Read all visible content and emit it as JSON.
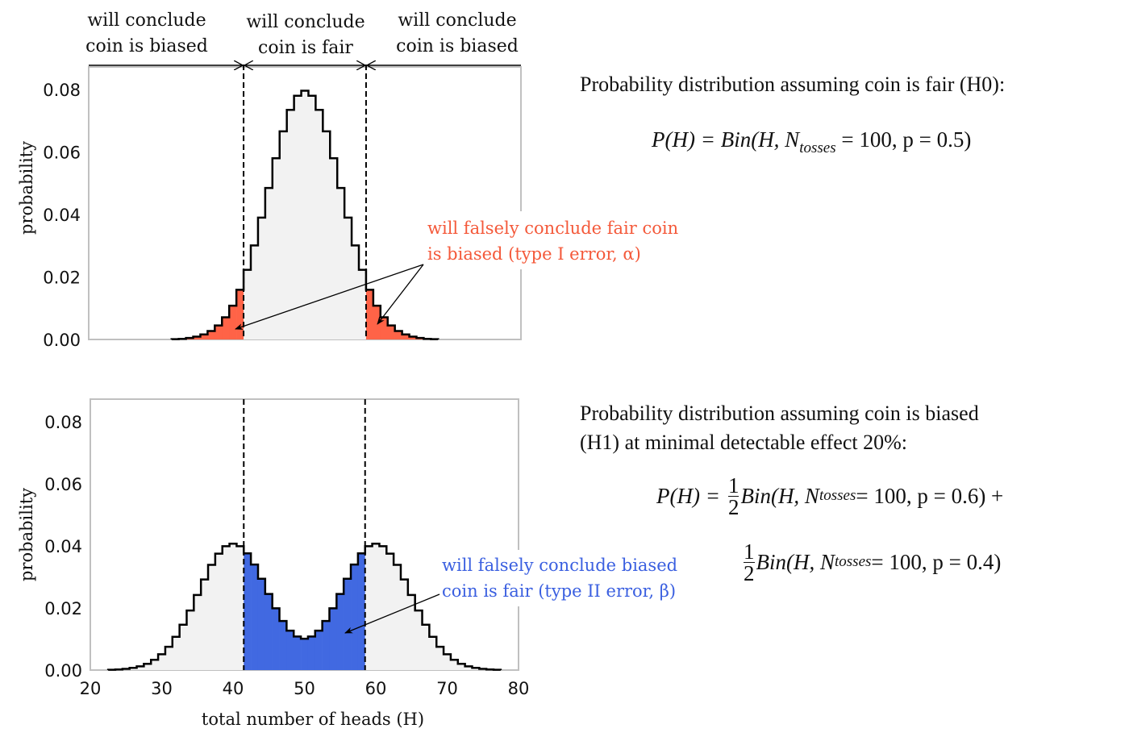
{
  "chart_data": [
    {
      "type": "bar",
      "subtype": "step-histogram",
      "title": "",
      "xlabel": "",
      "ylabel": "probability",
      "xlim": [
        20,
        80
      ],
      "ylim": [
        0,
        0.088
      ],
      "yticks": [
        "0.00",
        "0.02",
        "0.04",
        "0.06",
        "0.08"
      ],
      "xticks": [],
      "grid": false,
      "thresholds": [
        41.5,
        58.5
      ],
      "regions": [
        {
          "label_line1": "will conclude",
          "label_line2": "coin is biased"
        },
        {
          "label_line1": "will conclude",
          "label_line2": "coin is fair"
        },
        {
          "label_line1": "will conclude",
          "label_line2": "coin is biased"
        }
      ],
      "annotation": {
        "line1": "will falsely conclude fair coin",
        "line2": "is biased (type I error, α)",
        "color": "#f4593a"
      },
      "shade_color": "#ff6347",
      "fill_color": "#f2f2f2",
      "x": [
        32,
        33,
        34,
        35,
        36,
        37,
        38,
        39,
        40,
        41,
        42,
        43,
        44,
        45,
        46,
        47,
        48,
        49,
        50,
        51,
        52,
        53,
        54,
        55,
        56,
        57,
        58,
        59,
        60,
        61,
        62,
        63,
        64,
        65,
        66,
        67,
        68
      ],
      "values": [
        0.0001,
        0.0002,
        0.0005,
        0.0009,
        0.0016,
        0.0027,
        0.0045,
        0.0071,
        0.0108,
        0.0159,
        0.0223,
        0.0301,
        0.039,
        0.0485,
        0.058,
        0.0666,
        0.0735,
        0.078,
        0.0796,
        0.078,
        0.0735,
        0.0666,
        0.058,
        0.0485,
        0.039,
        0.0301,
        0.0223,
        0.0159,
        0.0108,
        0.0071,
        0.0045,
        0.0027,
        0.0016,
        0.0009,
        0.0005,
        0.0002,
        0.0001
      ]
    },
    {
      "type": "bar",
      "subtype": "step-histogram",
      "title": "",
      "xlabel": "total number of heads (H)",
      "ylabel": "probability",
      "xlim": [
        20,
        80
      ],
      "ylim": [
        0,
        0.088
      ],
      "yticks": [
        "0.00",
        "0.02",
        "0.04",
        "0.06",
        "0.08"
      ],
      "xticks": [
        "20",
        "30",
        "40",
        "50",
        "60",
        "70",
        "80"
      ],
      "grid": false,
      "thresholds": [
        41.5,
        58.5
      ],
      "annotation": {
        "line1": "will falsely conclude biased",
        "line2": "coin is fair (type II error, β)",
        "color": "#3a5fe0"
      },
      "shade_color": "#4169e1",
      "fill_color": "#f2f2f2",
      "x": [
        23,
        24,
        25,
        26,
        27,
        28,
        29,
        30,
        31,
        32,
        33,
        34,
        35,
        36,
        37,
        38,
        39,
        40,
        41,
        42,
        43,
        44,
        45,
        46,
        47,
        48,
        49,
        50,
        51,
        52,
        53,
        54,
        55,
        56,
        57,
        58,
        59,
        60,
        61,
        62,
        63,
        64,
        65,
        66,
        67,
        68,
        69,
        70,
        71,
        72,
        73,
        74,
        75,
        76,
        77
      ],
      "values": [
        0.0001,
        0.0002,
        0.0004,
        0.0007,
        0.0012,
        0.002,
        0.0033,
        0.0051,
        0.0075,
        0.0107,
        0.0146,
        0.0192,
        0.0242,
        0.0292,
        0.0339,
        0.0375,
        0.0399,
        0.0407,
        0.0399,
        0.0376,
        0.034,
        0.0294,
        0.0245,
        0.0199,
        0.0158,
        0.0127,
        0.0108,
        0.0101,
        0.0108,
        0.0127,
        0.0158,
        0.0199,
        0.0245,
        0.0294,
        0.034,
        0.0376,
        0.0399,
        0.0407,
        0.0399,
        0.0375,
        0.0339,
        0.0292,
        0.0242,
        0.0192,
        0.0146,
        0.0107,
        0.0075,
        0.0051,
        0.0033,
        0.002,
        0.0012,
        0.0007,
        0.0004,
        0.0002,
        0.0001
      ]
    }
  ],
  "right_text": {
    "h0_title": "Probability distribution assuming coin is fair (H0):",
    "h0_formula": {
      "lhs": "P(H) =",
      "body": "Bin(H, N",
      "sub": "tosses",
      "rest": " = 100, p = 0.5)"
    },
    "h1_title_line1": "Probability distribution assuming coin is biased",
    "h1_title_line2": "(H1) at minimal detectable effect 20%:",
    "h1_formula": {
      "lhs": "P(H) =",
      "frac_num": "1",
      "frac_den": "2",
      "term1_body": "Bin(H, N",
      "term1_sub": "tosses",
      "term1_rest": " = 100, p = 0.6) +",
      "term2_body": "Bin(H, N",
      "term2_sub": "tosses",
      "term2_rest": " = 100, p = 0.4)"
    }
  }
}
